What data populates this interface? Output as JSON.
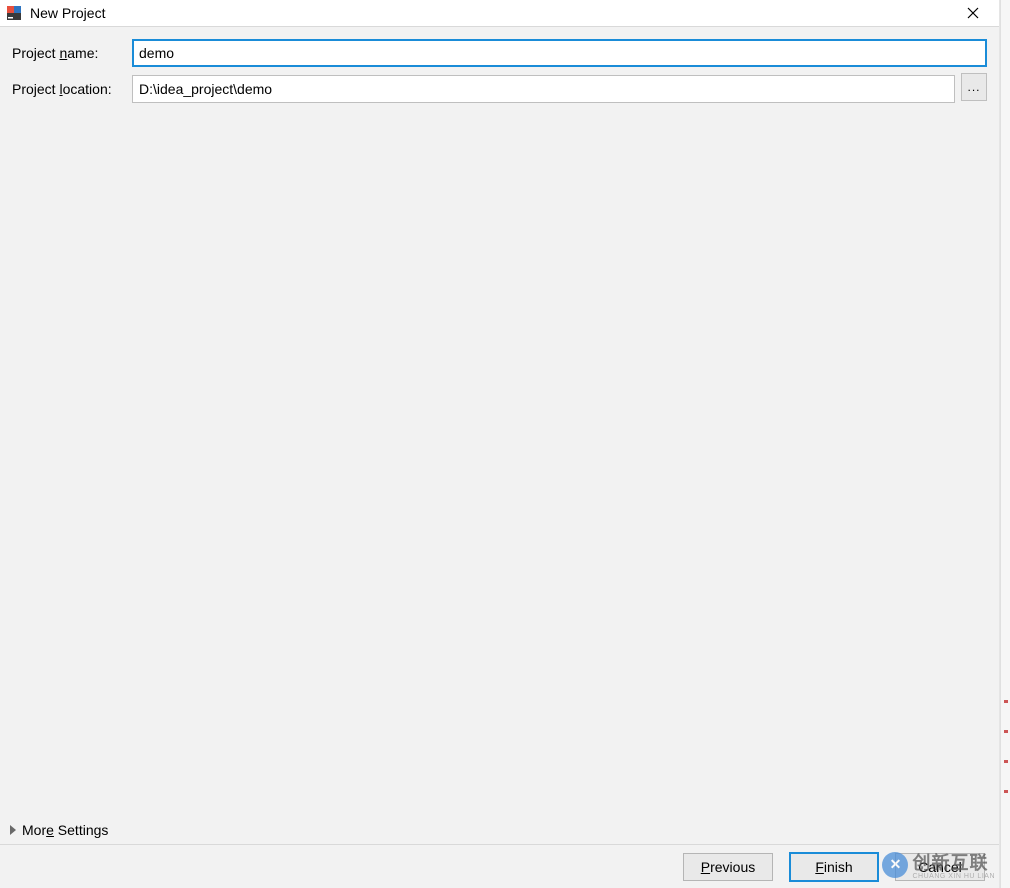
{
  "titlebar": {
    "title": "New Project"
  },
  "form": {
    "project_name_label_pre": "Project ",
    "project_name_label_mn": "n",
    "project_name_label_post": "ame:",
    "project_name_value": "demo",
    "project_location_label_pre": "Project ",
    "project_location_label_mn": "l",
    "project_location_label_post": "ocation:",
    "project_location_value": "D:\\idea_project\\demo",
    "browse_label": "..."
  },
  "more_settings": {
    "label_pre": "Mor",
    "label_mn": "e",
    "label_post": " Settings"
  },
  "footer": {
    "previous_pre": "",
    "previous_mn": "P",
    "previous_post": "revious",
    "finish_pre": "",
    "finish_mn": "F",
    "finish_post": "inish",
    "cancel_label": "Cancel"
  },
  "watermark": {
    "text": "创新互联",
    "sub": "CHUANG XIN HU LIAN",
    "icon_letter": "✕"
  }
}
